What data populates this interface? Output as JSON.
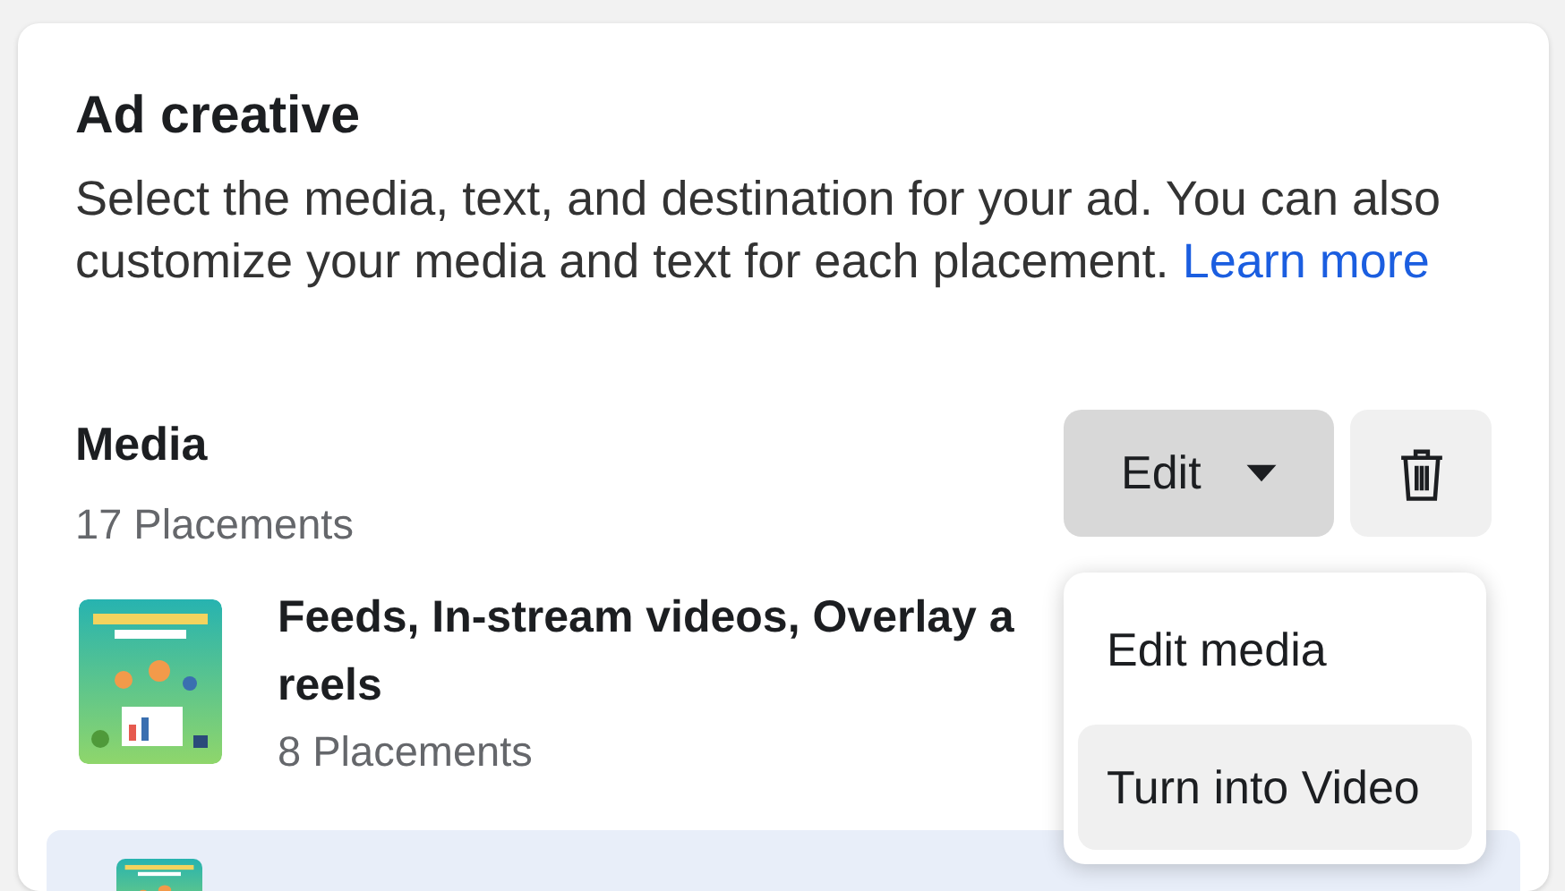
{
  "card": {
    "title": "Ad creative",
    "description": "Select the media, text, and destination for your ad. You can also customize your media and text for each placement.",
    "link": "Learn more"
  },
  "media": {
    "title": "Media",
    "placements": "17 Placements",
    "edit_button": "Edit",
    "items": [
      {
        "title_lines": [
          "Feeds, In-stream videos, Overlay a",
          "reels"
        ],
        "placements": "8 Placements",
        "selected": false,
        "kind": "picture"
      },
      {
        "selected": true,
        "kind": "picture"
      }
    ]
  },
  "dropdown": {
    "items": [
      {
        "label": "Edit media",
        "selected": false
      },
      {
        "label": "Turn into Video",
        "selected": true
      }
    ]
  }
}
